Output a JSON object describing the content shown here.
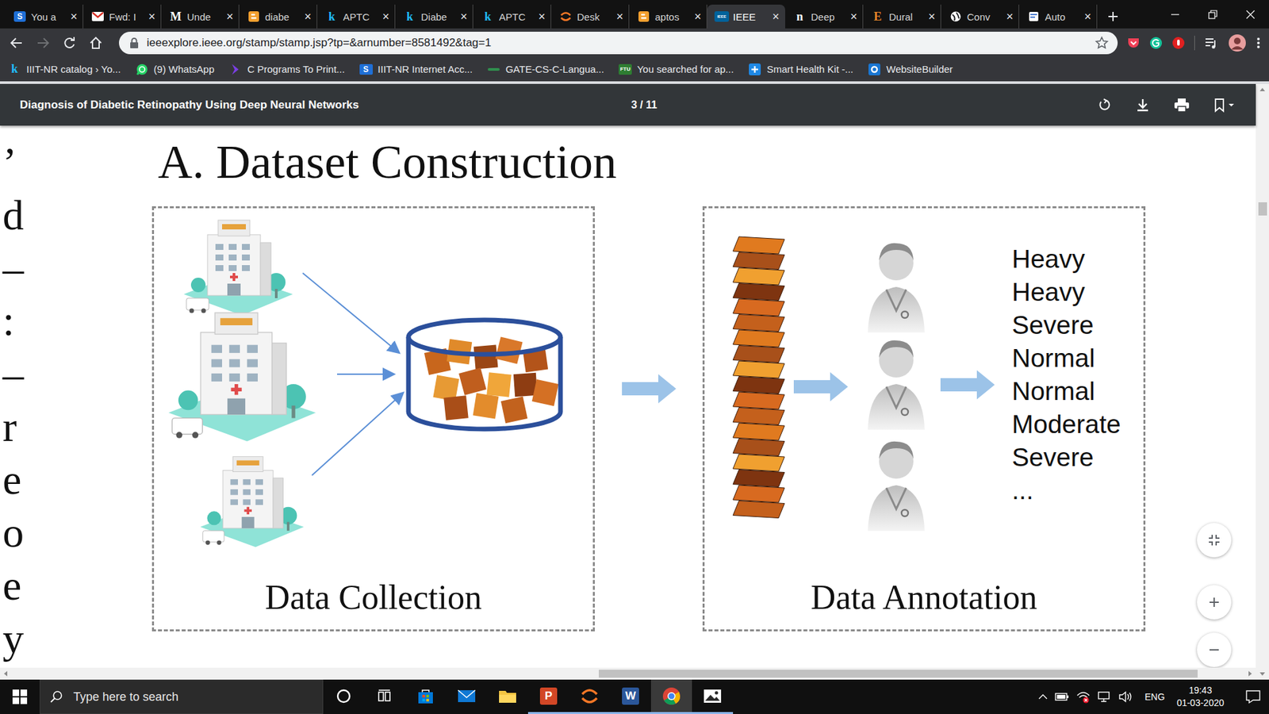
{
  "tabs": [
    {
      "label": "You a",
      "kind": "badge",
      "icon": "S",
      "color": "#1f6fd6",
      "selected": false
    },
    {
      "label": "Fwd: I",
      "kind": "gmail",
      "selected": false
    },
    {
      "label": "Unde",
      "kind": "letter",
      "icon": "M",
      "color": "#ffffff",
      "selected": false
    },
    {
      "label": "diabe",
      "kind": "doc",
      "selected": false
    },
    {
      "label": "APTC",
      "kind": "letter",
      "icon": "k",
      "color": "#20beff",
      "selected": false
    },
    {
      "label": "Diabe",
      "kind": "letter",
      "icon": "k",
      "color": "#20beff",
      "selected": false
    },
    {
      "label": "APTC",
      "kind": "letter",
      "icon": "k",
      "color": "#20beff",
      "selected": false
    },
    {
      "label": "Desk",
      "kind": "jupyter",
      "selected": false
    },
    {
      "label": "aptos",
      "kind": "doc",
      "selected": false
    },
    {
      "label": "IEEE",
      "kind": "badge",
      "icon": "IEEE",
      "color": "#00629b",
      "selected": true
    },
    {
      "label": "Deep",
      "kind": "letter",
      "icon": "n",
      "color": "#ffffff",
      "selected": false
    },
    {
      "label": "Dural",
      "kind": "letter",
      "icon": "E",
      "color": "#e8862a",
      "selected": false
    },
    {
      "label": "Conv",
      "kind": "globe",
      "selected": false
    },
    {
      "label": "Auto",
      "kind": "page",
      "selected": false
    }
  ],
  "tab_close": "×",
  "nav": {
    "back_enabled": true,
    "forward_enabled": false
  },
  "address_bar": {
    "url": "ieeexplore.ieee.org/stamp/stamp.jsp?tp=&arnumber=8581492&tag=1",
    "starred": false
  },
  "bookmarks": [
    {
      "label": "IIIT-NR catalog › Yo...",
      "kind": "letter",
      "icon": "k"
    },
    {
      "label": "(9) WhatsApp",
      "kind": "whatsapp"
    },
    {
      "label": "C Programs To Print...",
      "kind": "arrow"
    },
    {
      "label": "IIIT-NR Internet Acc...",
      "kind": "badge",
      "icon": "S"
    },
    {
      "label": "GATE-CS-C-Langua...",
      "kind": "dots"
    },
    {
      "label": "You searched for ap...",
      "kind": "badge",
      "icon": "FTU"
    },
    {
      "label": "Smart Health Kit -...",
      "kind": "plus"
    },
    {
      "label": "WebsiteBuilder",
      "kind": "gear"
    }
  ],
  "pdf_viewer": {
    "title": "Diagnosis of Diabetic Retinopathy Using Deep Neural Networks",
    "page": "3 / 11"
  },
  "document": {
    "margin_fragments": [
      "’",
      "d",
      "–",
      ":",
      "–",
      "r",
      "e",
      "o",
      "e",
      "y"
    ],
    "figure": {
      "heading": "A. Dataset Construction",
      "collection": {
        "caption": "Data Collection"
      },
      "annotation": {
        "caption": "Data Annotation",
        "labels": [
          "Heavy",
          "Heavy",
          "Severe",
          "Normal",
          "Normal",
          "Moderate",
          "Severe",
          "..."
        ]
      }
    }
  },
  "taskbar": {
    "search_placeholder": "Type here to search",
    "apps": [
      {
        "kind": "cortana",
        "running": false,
        "selected": false
      },
      {
        "kind": "task-view",
        "running": false,
        "selected": false
      },
      {
        "kind": "store",
        "running": false,
        "selected": false
      },
      {
        "kind": "mail",
        "running": false,
        "selected": false
      },
      {
        "kind": "explorer",
        "running": false,
        "selected": false
      },
      {
        "kind": "powerpoint",
        "glyph": "P",
        "running": true,
        "selected": false
      },
      {
        "kind": "jupyter",
        "running": true,
        "selected": false
      },
      {
        "kind": "word",
        "glyph": "W",
        "running": true,
        "selected": false
      },
      {
        "kind": "chrome",
        "running": true,
        "selected": true
      },
      {
        "kind": "photos",
        "running": true,
        "selected": false
      }
    ],
    "language": "ENG",
    "time": "19:43",
    "date": "01-03-2020"
  }
}
